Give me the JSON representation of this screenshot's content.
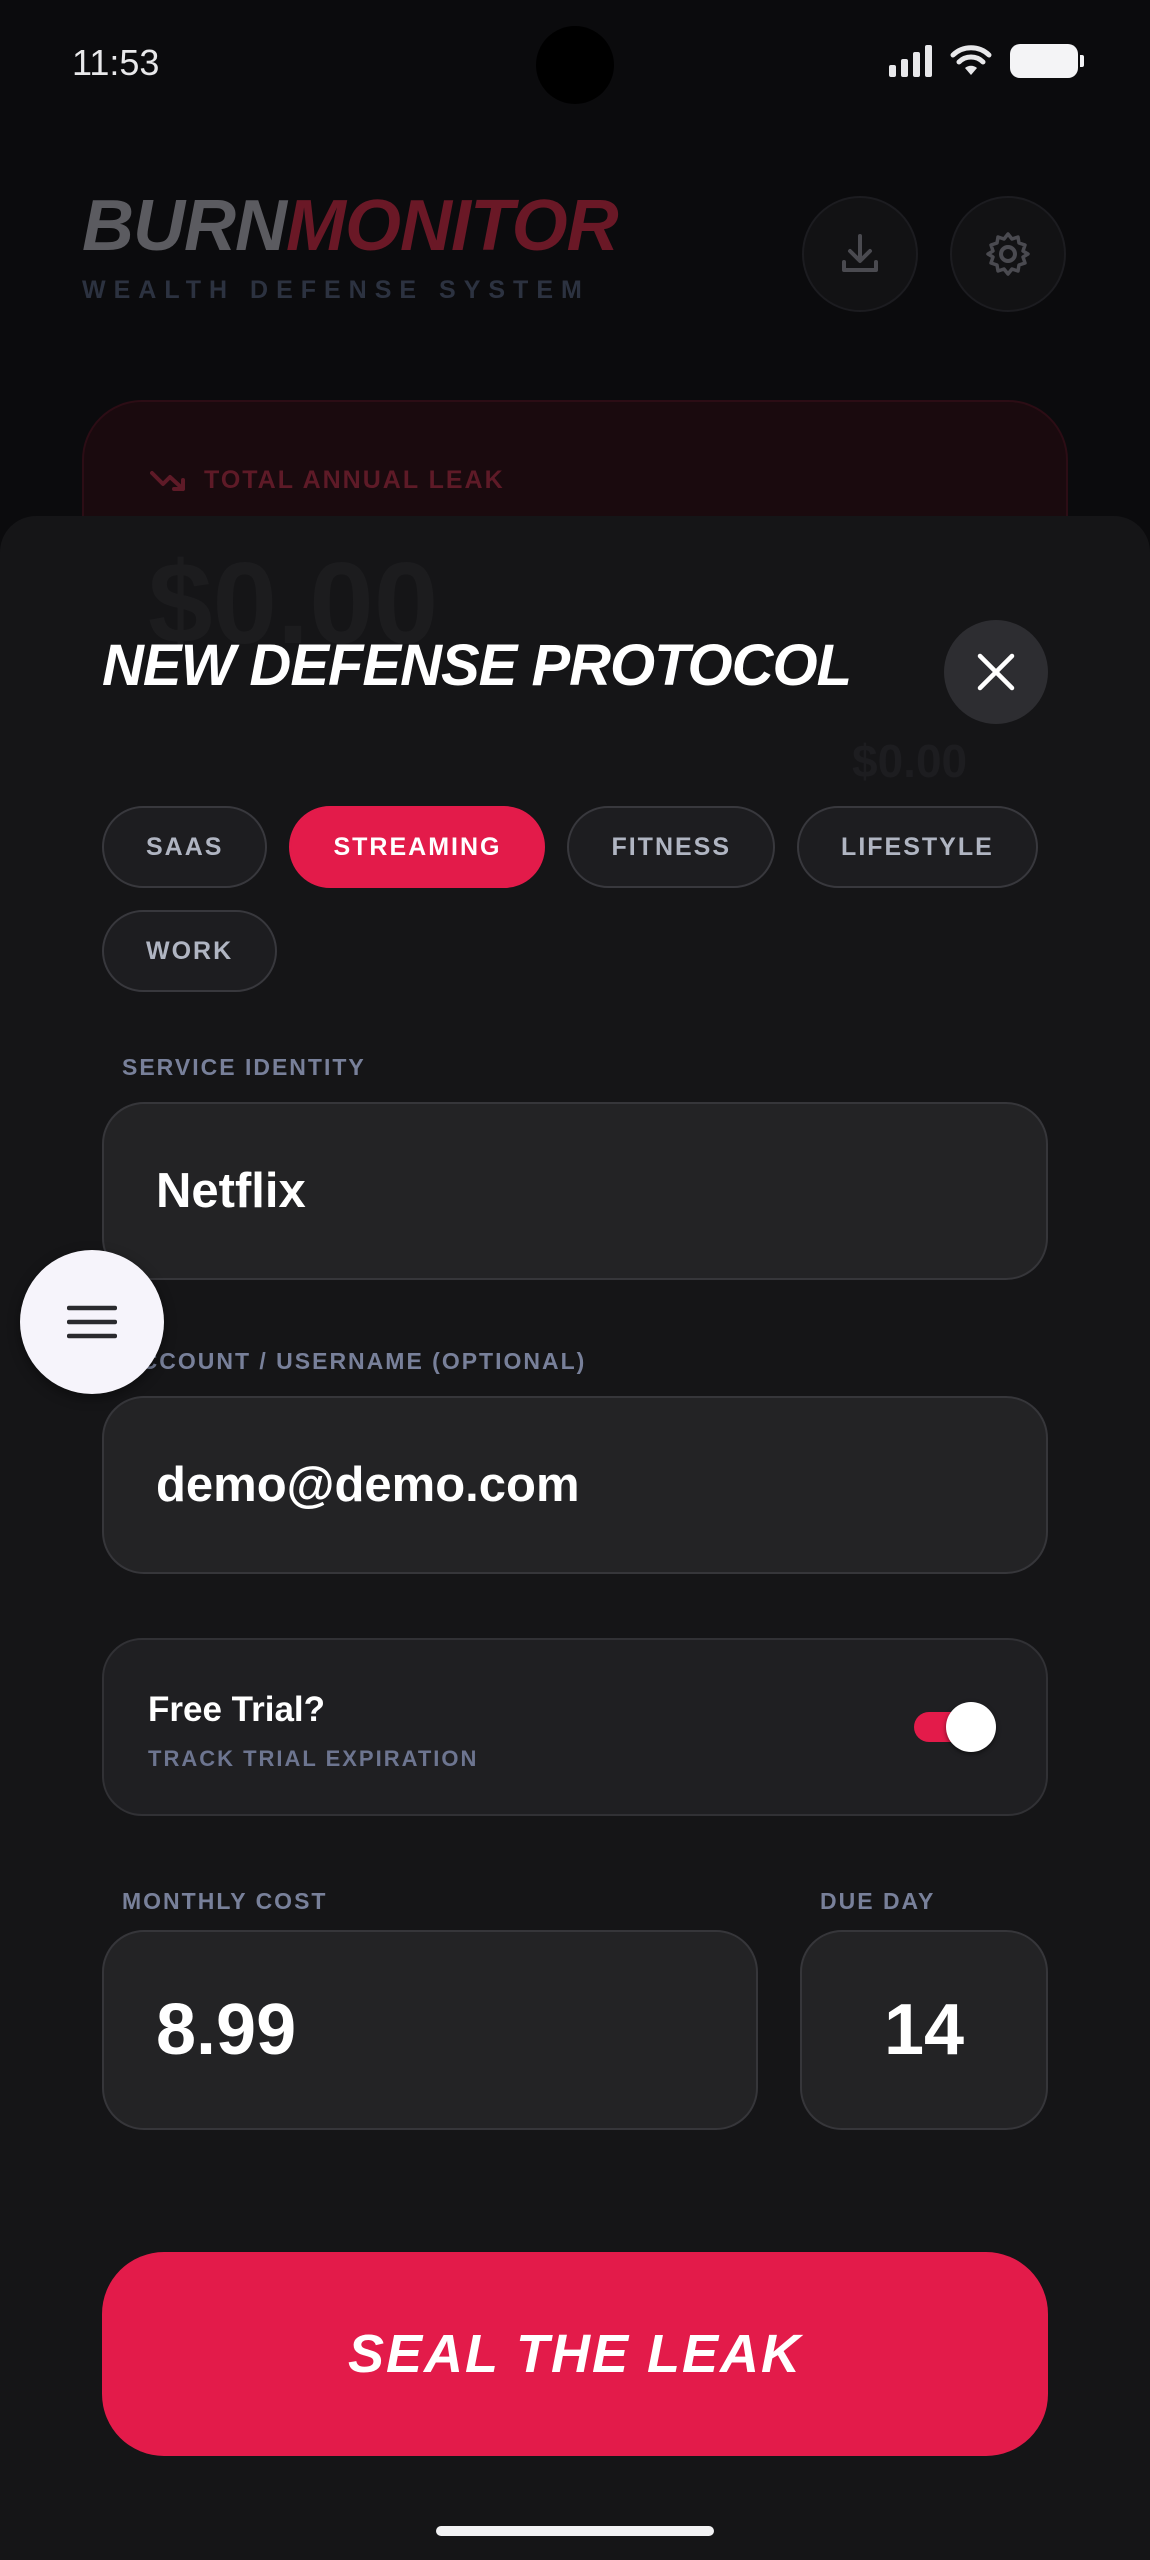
{
  "status_bar": {
    "time": "11:53"
  },
  "header": {
    "logo_part1": "BURN",
    "logo_part2": "MONITOR",
    "tagline": "WEALTH DEFENSE SYSTEM",
    "download_icon": "download-icon",
    "settings_icon": "gear-icon"
  },
  "summary_card": {
    "label": "TOTAL ANNUAL LEAK",
    "amount": "$0.00",
    "secondary_amount": "$0.00"
  },
  "sheet": {
    "title": "NEW DEFENSE PROTOCOL",
    "categories": [
      {
        "label": "SAAS",
        "active": false
      },
      {
        "label": "STREAMING",
        "active": true
      },
      {
        "label": "FITNESS",
        "active": false
      },
      {
        "label": "LIFESTYLE",
        "active": false
      },
      {
        "label": "WORK",
        "active": false
      }
    ],
    "service": {
      "label": "SERVICE IDENTITY",
      "value": "Netflix"
    },
    "account": {
      "label": "ACCOUNT / USERNAME (OPTIONAL)",
      "value": "demo@demo.com"
    },
    "trial": {
      "title": "Free Trial?",
      "subtitle": "TRACK TRIAL EXPIRATION",
      "enabled": true
    },
    "cost": {
      "label": "MONTHLY COST",
      "value": "8.99"
    },
    "due_day": {
      "label": "DUE DAY",
      "value": "14"
    },
    "submit_label": "SEAL THE LEAK"
  },
  "colors": {
    "accent": "#e31b4a",
    "sheet_bg": "#151517",
    "field_bg": "#232325"
  }
}
